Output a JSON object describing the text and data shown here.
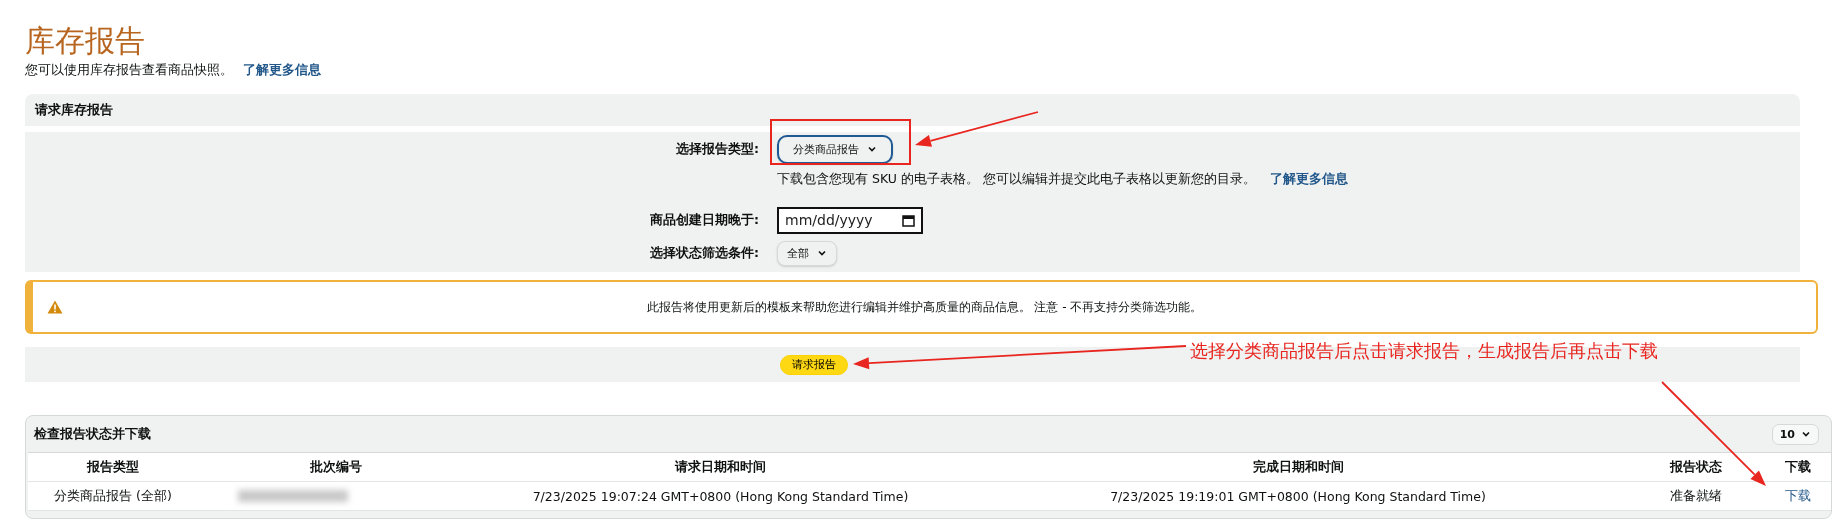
{
  "page": {
    "title": "库存报告",
    "subtitle": "您可以使用库存报告查看商品快照。",
    "learn_more_link": "了解更多信息"
  },
  "request_section": {
    "title": "请求库存报告",
    "report_type": {
      "label": "选择报告类型:",
      "value": "分类商品报告",
      "description": "下载包含您现有 SKU 的电子表格。 您可以编辑并提交此电子表格以更新您的目录。",
      "learn_more_link": "了解更多信息"
    },
    "created_after": {
      "label": "商品创建日期晚于:",
      "placeholder": "mm/dd/yyyy"
    },
    "status_filter": {
      "label": "选择状态筛选条件:",
      "value": "全部"
    },
    "warning": "此报告将使用更新后的模板来帮助您进行编辑并维护高质量的商品信息。 注意 - 不再支持分类筛选功能。",
    "request_button": "请求报告"
  },
  "status_section": {
    "title": "检查报告状态并下载",
    "page_size": "10",
    "table": {
      "columns": [
        "报告类型",
        "批次编号",
        "请求日期和时间",
        "完成日期和时间",
        "报告状态",
        "下载"
      ],
      "rows": [
        {
          "report_type": "分类商品报告 (全部)",
          "requested": "7/23/2025 19:07:24 GMT+0800 (Hong Kong Standard Time)",
          "completed": "7/23/2025 19:19:01 GMT+0800 (Hong Kong Standard Time)",
          "status": "准备就绪",
          "download_link": "下载"
        }
      ]
    }
  },
  "annotation": {
    "note": "选择分类商品报告后点击请求报告，生成报告后再点击下载"
  }
}
